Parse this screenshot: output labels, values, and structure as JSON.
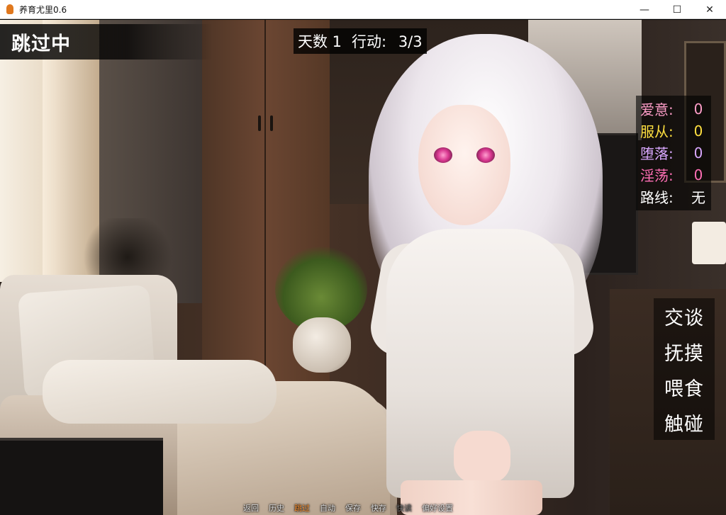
{
  "window": {
    "title": "养育尤里0.6",
    "minimize_glyph": "—",
    "maximize_glyph": "☐",
    "close_glyph": "✕"
  },
  "hud": {
    "skip_indicator": "跳过中",
    "day_label": "天数 1",
    "action_label": "行动:",
    "action_value": "3/3"
  },
  "stats": [
    {
      "label": "爱意:",
      "value": "0",
      "color": "#ff9ec9"
    },
    {
      "label": "服从:",
      "value": "0",
      "color": "#ffe040"
    },
    {
      "label": "堕落:",
      "value": "0",
      "color": "#d9a8ff"
    },
    {
      "label": "淫荡:",
      "value": "0",
      "color": "#ff6fb5"
    },
    {
      "label": "路线:",
      "value": "无",
      "color": "#ffffff"
    }
  ],
  "actions": [
    "交谈",
    "抚摸",
    "喂食",
    "触碰"
  ],
  "quick_menu": [
    {
      "label": "返回",
      "state": "normal"
    },
    {
      "label": "历史",
      "state": "normal"
    },
    {
      "label": "跳过",
      "state": "active"
    },
    {
      "label": "自动",
      "state": "normal"
    },
    {
      "label": "保存",
      "state": "normal"
    },
    {
      "label": "快存",
      "state": "normal"
    },
    {
      "label": "快读",
      "state": "dim"
    },
    {
      "label": "偏好设置",
      "state": "normal"
    }
  ]
}
